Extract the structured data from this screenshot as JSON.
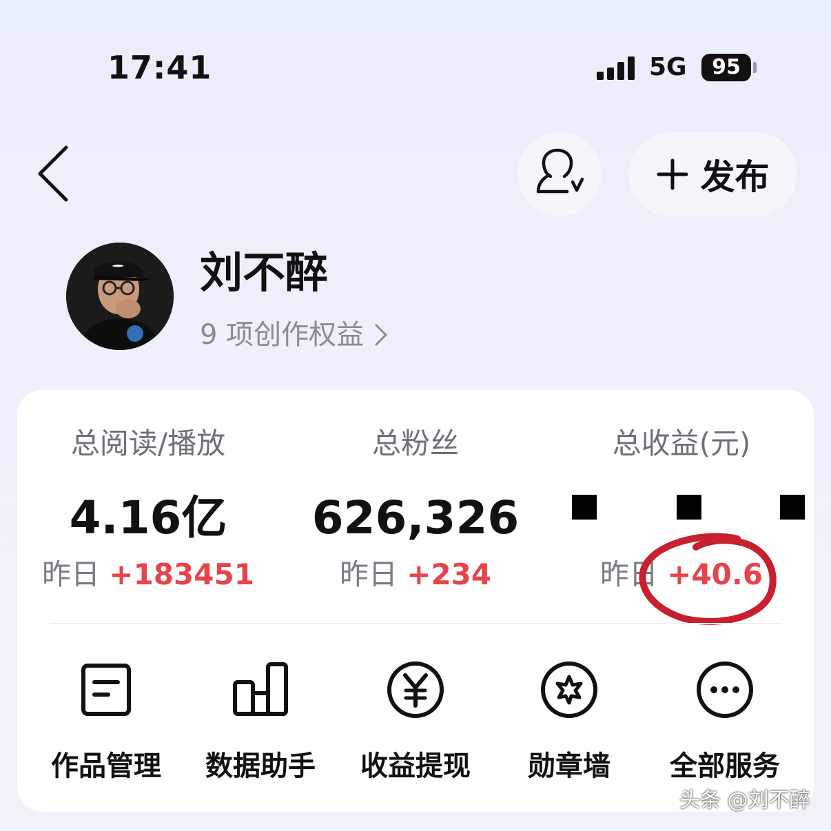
{
  "status_bar": {
    "time": "17:41",
    "network": "5G",
    "battery": "95"
  },
  "header": {
    "publish_label": "发布",
    "icons": [
      "back-icon",
      "user-check-icon",
      "plus-icon"
    ]
  },
  "profile": {
    "name": "刘不醉",
    "rights_text": "9 项创作权益"
  },
  "stats": [
    {
      "label": "总阅读/播放",
      "value": "4.16亿",
      "delta_prefix": "昨日",
      "delta": "+183451"
    },
    {
      "label": "总粉丝",
      "value": "626,326",
      "delta_prefix": "昨日",
      "delta": "+234"
    },
    {
      "label": "总收益(元)",
      "value": "",
      "delta_prefix": "昨日",
      "delta": "+40.6"
    }
  ],
  "services": [
    {
      "label": "作品管理",
      "icon": "document-icon"
    },
    {
      "label": "数据助手",
      "icon": "bar-chart-icon"
    },
    {
      "label": "收益提现",
      "icon": "yuan-icon"
    },
    {
      "label": "勋章墙",
      "icon": "medal-icon"
    },
    {
      "label": "全部服务",
      "icon": "more-icon"
    }
  ],
  "watermark": "头条 @刘不醉",
  "colors": {
    "accent_red": "#e8434a",
    "annotation_red": "#c8202e"
  }
}
